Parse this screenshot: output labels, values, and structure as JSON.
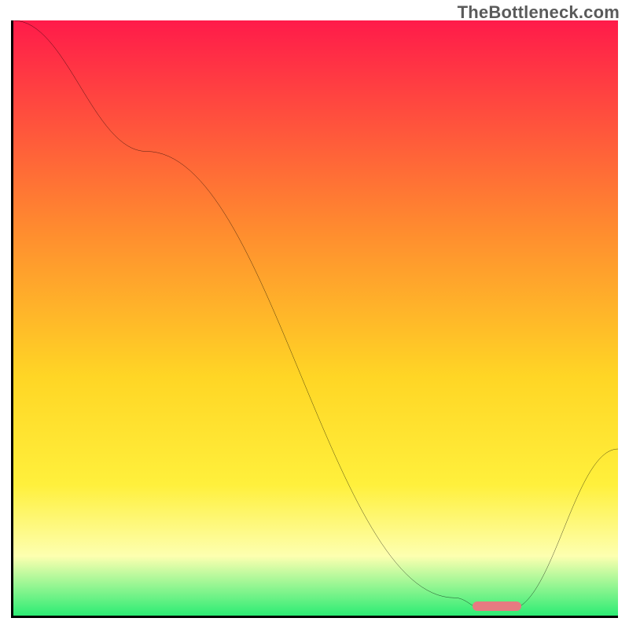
{
  "watermark": "TheBottleneck.com",
  "colors": {
    "top": "#ff1b4a",
    "mid1": "#ff8b2f",
    "mid2": "#ffd625",
    "mid3": "#fff03c",
    "mid4": "#fdffb0",
    "bottom": "#2cec74",
    "curve": "#000000",
    "marker": "#e77a81"
  },
  "chart_data": {
    "type": "line",
    "title": "",
    "xlabel": "",
    "ylabel": "",
    "xlim": [
      0,
      100
    ],
    "ylim": [
      0,
      100
    ],
    "series": [
      {
        "name": "bottleneck-curve",
        "x": [
          0,
          22,
          73,
          78,
          82,
          100
        ],
        "values": [
          100,
          78,
          3,
          1,
          1,
          28
        ]
      }
    ],
    "marker": {
      "x_start": 76,
      "x_end": 84,
      "y": 0.8
    },
    "gradient_stops": [
      {
        "offset": 0,
        "key": "top"
      },
      {
        "offset": 35,
        "key": "mid1"
      },
      {
        "offset": 60,
        "key": "mid2"
      },
      {
        "offset": 78,
        "key": "mid3"
      },
      {
        "offset": 90,
        "key": "mid4"
      },
      {
        "offset": 100,
        "key": "bottom"
      }
    ]
  }
}
